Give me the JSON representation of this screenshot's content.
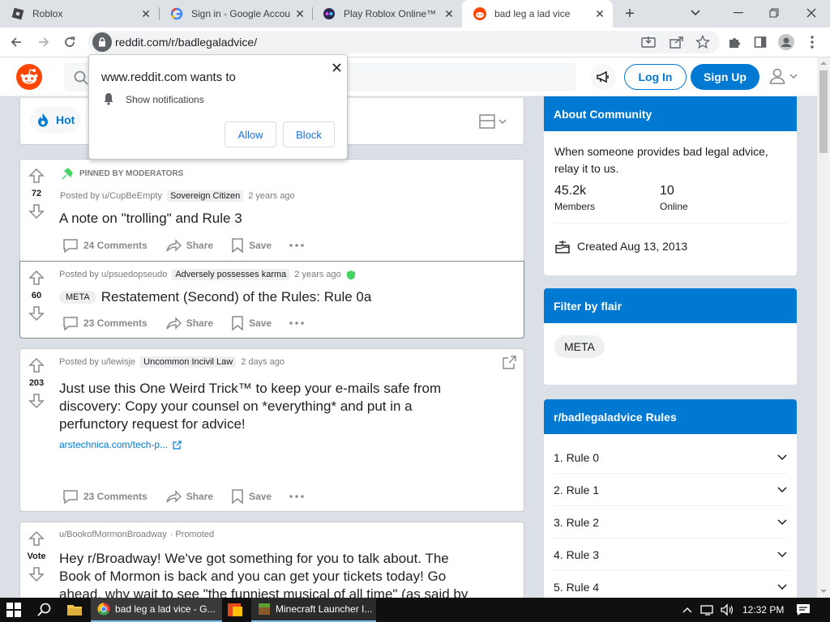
{
  "browser": {
    "tabs": [
      {
        "title": "Roblox",
        "active": false
      },
      {
        "title": "Sign in - Google Accou",
        "active": false
      },
      {
        "title": "Play Roblox Online™",
        "active": false
      },
      {
        "title": "bad leg a lad vice",
        "active": true
      }
    ],
    "url": "reddit.com/r/badlegaladvice/"
  },
  "notification_popup": {
    "title": "www.reddit.com wants to",
    "permission": "Show notifications",
    "allow_label": "Allow",
    "block_label": "Block"
  },
  "reddit_header": {
    "login_label": "Log In",
    "signup_label": "Sign Up"
  },
  "sort_bar": {
    "hot_label": "Hot"
  },
  "posts": [
    {
      "pinned_label": "PINNED BY MODERATORS",
      "votes": "72",
      "author": "Posted by u/CupBeEmpty",
      "flair": "Sovereign Citizen",
      "time": "2 years ago",
      "title": "A note on \"trolling\" and Rule 3",
      "comments": "24 Comments",
      "share": "Share",
      "save": "Save"
    },
    {
      "votes": "60",
      "author": "Posted by u/psuedopseudo",
      "flair": "Adversely possesses karma",
      "time": "2 years ago",
      "post_flair": "META",
      "title": "Restatement (Second) of the Rules: Rule 0a",
      "comments": "23 Comments",
      "share": "Share",
      "save": "Save"
    },
    {
      "votes": "203",
      "author": "Posted by u/lewisje",
      "flair": "Uncommon Incivil Law",
      "time": "2 days ago",
      "title_lines": [
        "Just use this One Weird Trick™ to keep your e-mails safe from",
        "discovery: Copy your counsel on *everything* and put in a",
        "perfunctory request for advice!"
      ],
      "link": "arstechnica.com/tech-p...",
      "comments": "23 Comments",
      "share": "Share",
      "save": "Save"
    },
    {
      "votes": "Vote",
      "author": "u/BookofMormonBroadway",
      "promoted": "· Promoted",
      "title_lines": [
        "Hey r/Broadway! We've got something for you to talk about. The",
        "Book of Mormon is back and you can get your tickets today! Go",
        "ahead, why wait to see \"the funniest musical of all time\" (as said by"
      ]
    }
  ],
  "about": {
    "header": "About Community",
    "description_lines": [
      "When someone provides bad legal advice,",
      "relay it to us."
    ],
    "members_value": "45.2k",
    "members_label": "Members",
    "online_value": "10",
    "online_label": "Online",
    "created": "Created Aug 13, 2013"
  },
  "filter": {
    "header": "Filter by flair",
    "flair": "META"
  },
  "rules": {
    "header": "r/badlegaladvice Rules",
    "items": [
      "1. Rule 0",
      "2. Rule 1",
      "3. Rule 2",
      "4. Rule 3",
      "5. Rule 4"
    ]
  },
  "taskbar": {
    "items": [
      {
        "label": "bad leg a lad vice - G..."
      },
      {
        "label": "Minecraft Launcher I..."
      }
    ],
    "clock": "12:32 PM"
  },
  "colors": {
    "reddit_orange": "#ff4500",
    "reddit_blue": "#0079d3",
    "mod_green": "#46d160"
  }
}
